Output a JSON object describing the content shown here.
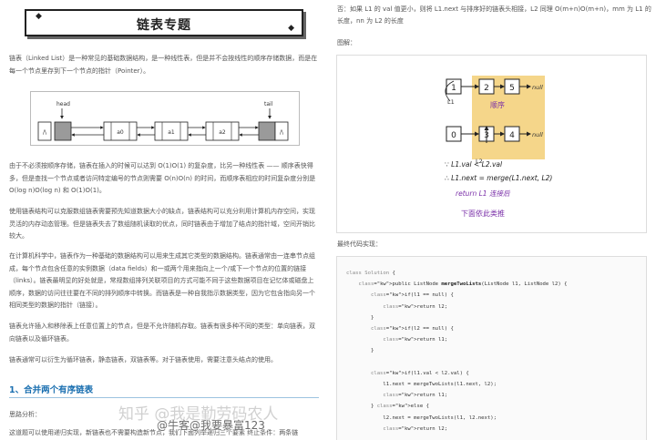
{
  "doc": {
    "title": "链表专题",
    "intro": "链表（Linked List）是一种常见的基础数据结构，是一种线性表，但是并不会按线性的顺序存储数据，而是在每一个节点里存到下一个节点的指针（Pointer）。",
    "para2": "由于不必须按顺序存储，链表在插入的时候可以达到 O(1)O(1) 的复杂度，比另一种线性表 —— 顺序表快得多，但是查找一个节点或者访问特定编号的节点则需要 O(n)O(n) 的时间，而顺序表相应的时间复杂度分别是 O(log n)O(log n) 和 O(1)O(1)。",
    "para3": "使用链表结构可以克服数组链表需要预先知道数据大小的缺点，链表结构可以充分利用计算机内存空间，实现灵活的内存动态管理。但是链表失去了数组随机读取的优点，同时链表由于增加了结点的指针域，空间开销比较大。",
    "para4": "在计算机科学中，链表作为一种基础的数据结构可以用来生成其它类型的数据结构。链表通常由一连串节点组成，每个节点包含任意的实例数据（data fields）和一或两个用来指向上一个/或下一个节点的位置的链接（links）。链表最明显的好处就是，常规数组排列关联项目的方式可能不同于这些数据项目在记忆体或磁盘上顺序，数据的访问往往要在不同的排列顺序中转换。而链表是一种自我指示数据类型，因为它包含指向另一个相同类型的数据的指针（链接）。",
    "para5": "链表允许插入和移除表上任意位置上的节点，但是不允许随机存取。链表有很多种不同的类型：单向链表，双向链表以及循环链表。",
    "para6": "链表通常可以衍生为循环链表，静态链表，双链表等。对于链表使用，需要注意头结点的使用。",
    "section_heading": "1、合并两个有序链表",
    "subheading": "思路分析：",
    "last_line": "这道题可以使用递归实现，新链表也不需要构造新节点，我们下面列举递归三个要素 终止条件：两条链"
  },
  "linked_list": {
    "head_label": "head",
    "tail_label": "tail",
    "nodes": [
      "/\\",
      "",
      "a0",
      "a1",
      "a2",
      "",
      "/\\"
    ]
  },
  "right": {
    "top_text": "否：如果 L1 的 val 值更小，则将 L1.next 与排序好的链表头相接，L2 同理 O(m+n)O(m+n)，mm 为 L1 的长度，nn 为 L2 的长度",
    "figure_label": "图解：",
    "code_label": "最终代码实现：",
    "figure": {
      "row1": [
        "1",
        "2",
        "5"
      ],
      "row2": [
        "0",
        "3",
        "4"
      ],
      "null_label": "null",
      "l1": "L1",
      "l2": "L2",
      "ordered": "顺序",
      "note1": "∵ L1.val < L2.val",
      "note2": "∴ L1.next = merge(L1.next, L2)",
      "note3": "return L1 连接后",
      "note4": "下面依此类推"
    },
    "code": [
      "class Solution {",
      "    public ListNode mergeTwoLists(ListNode l1, ListNode l2) {",
      "        if(l1 == null) {",
      "            return l2;",
      "        }",
      "        if(l2 == null) {",
      "            return l1;",
      "        }",
      "",
      "        if(l1.val < l2.val) {",
      "            l1.next = mergeTwoLists(l1.next, l2);",
      "            return l1;",
      "        } else {",
      "            l2.next = mergeTwoLists(l1, l2.next);",
      "            return l2;"
    ]
  },
  "watermark": {
    "zhihu": "知乎 @我是勤劳码农人",
    "nowcoder": "@牛客@我要暴富123"
  }
}
